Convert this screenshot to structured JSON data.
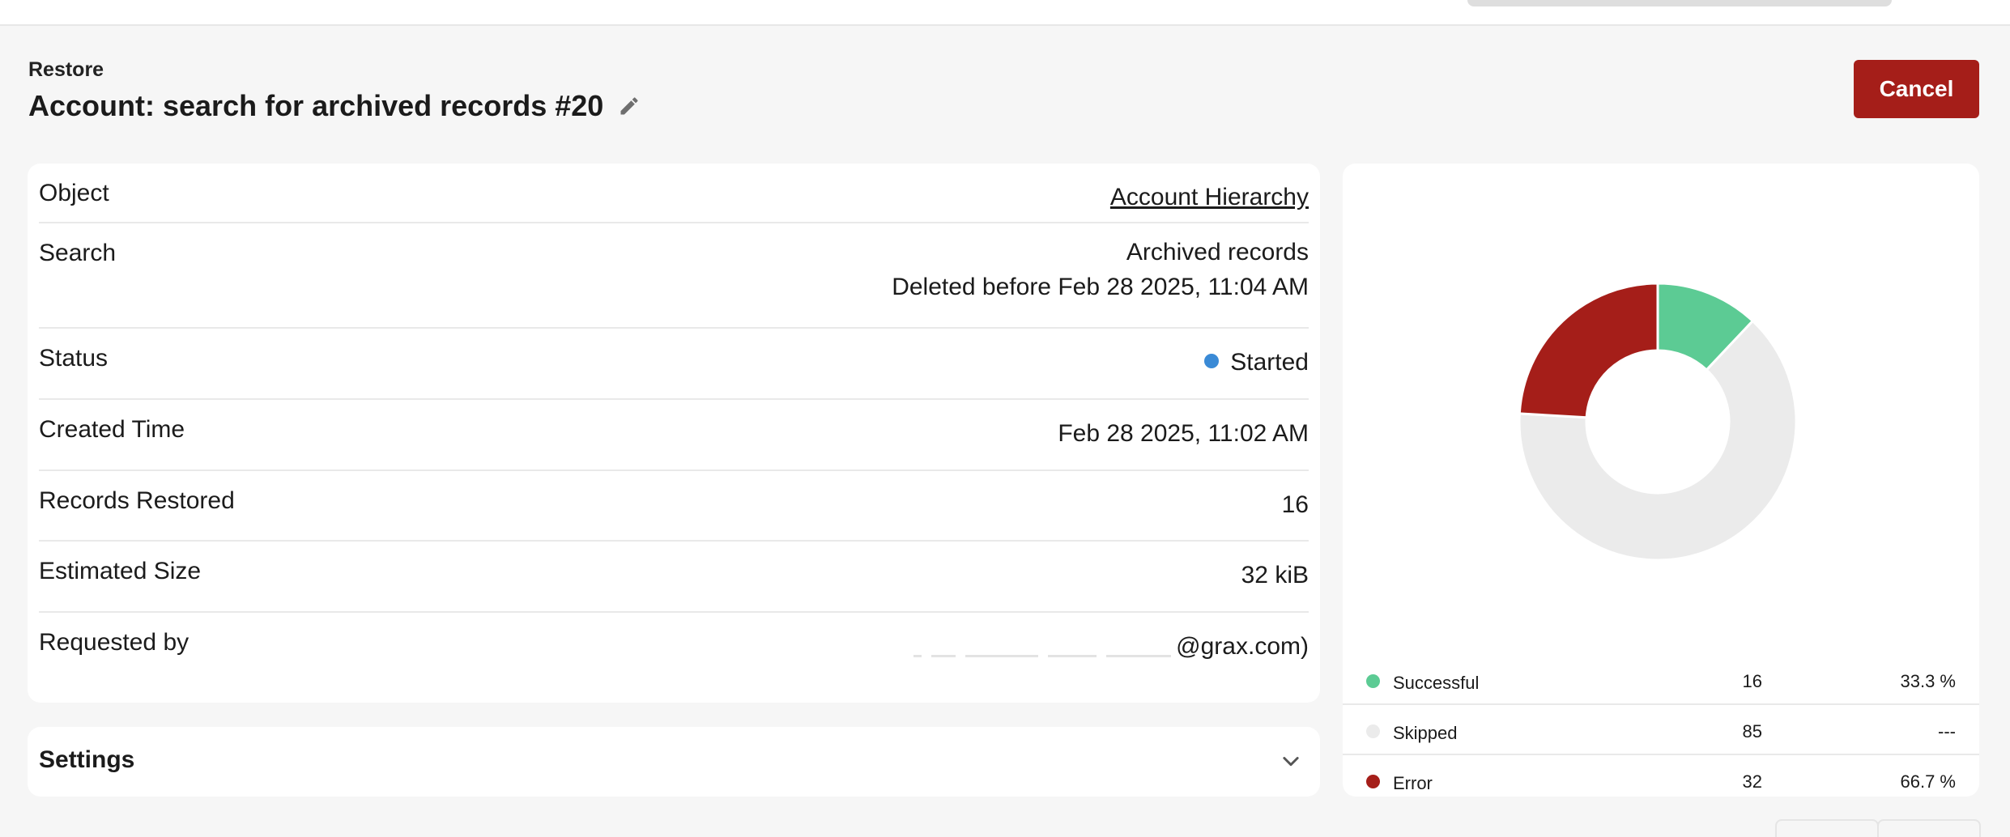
{
  "header": {
    "section_label": "Restore",
    "title": "Account: search for archived records #20",
    "edit_icon": "pencil-icon",
    "cancel_label": "Cancel",
    "cancel_color": "#a51e19"
  },
  "details": {
    "object": {
      "label": "Object",
      "value": "Account Hierarchy"
    },
    "search": {
      "label": "Search",
      "line1": "Archived records",
      "line2": "Deleted before Feb 28 2025, 11:04 AM"
    },
    "status": {
      "label": "Status",
      "value": "Started",
      "dot_color": "#3a8ad6"
    },
    "created_time": {
      "label": "Created Time",
      "value": "Feb 28 2025, 11:02 AM"
    },
    "records_restored": {
      "label": "Records Restored",
      "value": "16"
    },
    "estimated_size": {
      "label": "Estimated Size",
      "value": "32 kiB"
    },
    "requested_by": {
      "label": "Requested by",
      "value_suffix": "@grax.com)"
    }
  },
  "settings": {
    "title": "Settings",
    "chevron_icon": "chevron-down-icon"
  },
  "chart_data": {
    "type": "pie",
    "variant": "donut",
    "legend_position": "bottom",
    "slices": [
      {
        "label": "Successful",
        "count": 16,
        "percent": "33.3 %",
        "color": "#5ccb94"
      },
      {
        "label": "Skipped",
        "count": 85,
        "percent": "---",
        "color": "#ebebeb"
      },
      {
        "label": "Error",
        "count": 32,
        "percent": "66.7 %",
        "color": "#a51e19"
      }
    ]
  }
}
